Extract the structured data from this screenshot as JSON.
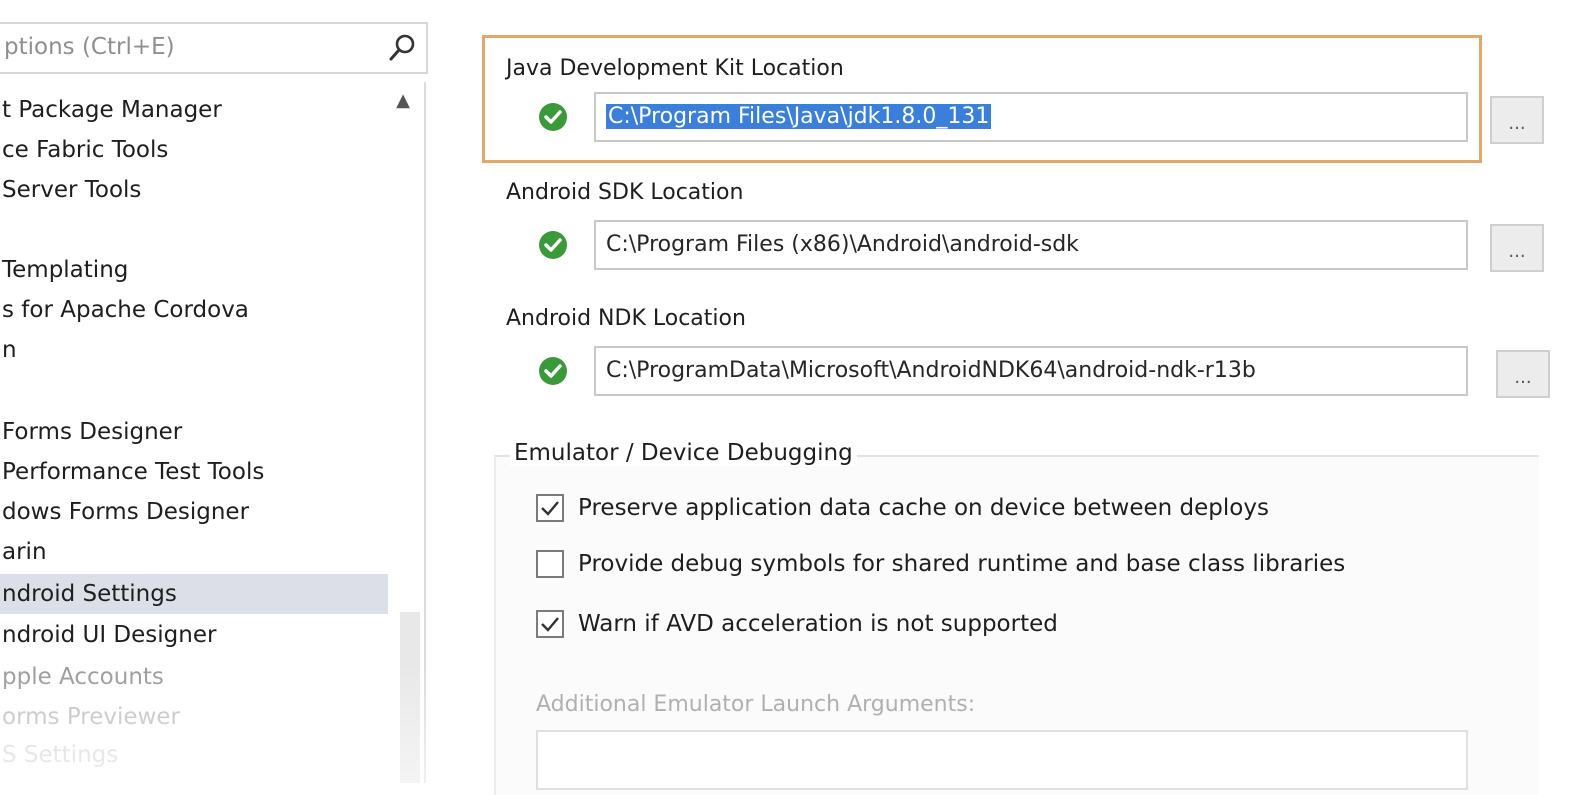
{
  "search": {
    "placeholder": "ptions (Ctrl+E)"
  },
  "tree": {
    "items": [
      {
        "label": "t Package Manager"
      },
      {
        "label": "ce Fabric Tools"
      },
      {
        "label": "Server Tools"
      },
      {
        "label": ""
      },
      {
        "label": "Templating"
      },
      {
        "label": "s for Apache Cordova"
      },
      {
        "label": "n"
      },
      {
        "label": ""
      },
      {
        "label": "Forms Designer"
      },
      {
        "label": "Performance Test Tools"
      },
      {
        "label": "dows Forms Designer"
      },
      {
        "label": "arin"
      },
      {
        "label": "ndroid Settings"
      },
      {
        "label": "ndroid UI Designer"
      },
      {
        "label": "pple Accounts"
      },
      {
        "label": "orms Previewer"
      },
      {
        "label": "S Settings"
      }
    ]
  },
  "settings": {
    "jdk": {
      "label": "Java Development Kit Location",
      "value": "C:\\Program Files\\Java\\jdk1.8.0_131",
      "browse": "..."
    },
    "sdk": {
      "label": "Android SDK Location",
      "value": "C:\\Program Files (x86)\\Android\\android-sdk",
      "browse": "..."
    },
    "ndk": {
      "label": "Android NDK Location",
      "value": "C:\\ProgramData\\Microsoft\\AndroidNDK64\\android-ndk-r13b",
      "browse": "..."
    }
  },
  "debugging": {
    "title": "Emulator / Device Debugging",
    "options": [
      {
        "label": "Preserve application data cache on device between deploys",
        "checked": true
      },
      {
        "label": "Provide debug symbols for shared runtime and base class libraries",
        "checked": false
      },
      {
        "label": "Warn if AVD acceleration is not supported",
        "checked": true
      }
    ],
    "args_label": "Additional Emulator Launch Arguments:",
    "args_value": ""
  },
  "colors": {
    "status_ok": "#3a9a3a",
    "selection": "#3a7fd9",
    "focus_border": "#e2a76a",
    "selected_item_bg": "#dcdfe8"
  }
}
